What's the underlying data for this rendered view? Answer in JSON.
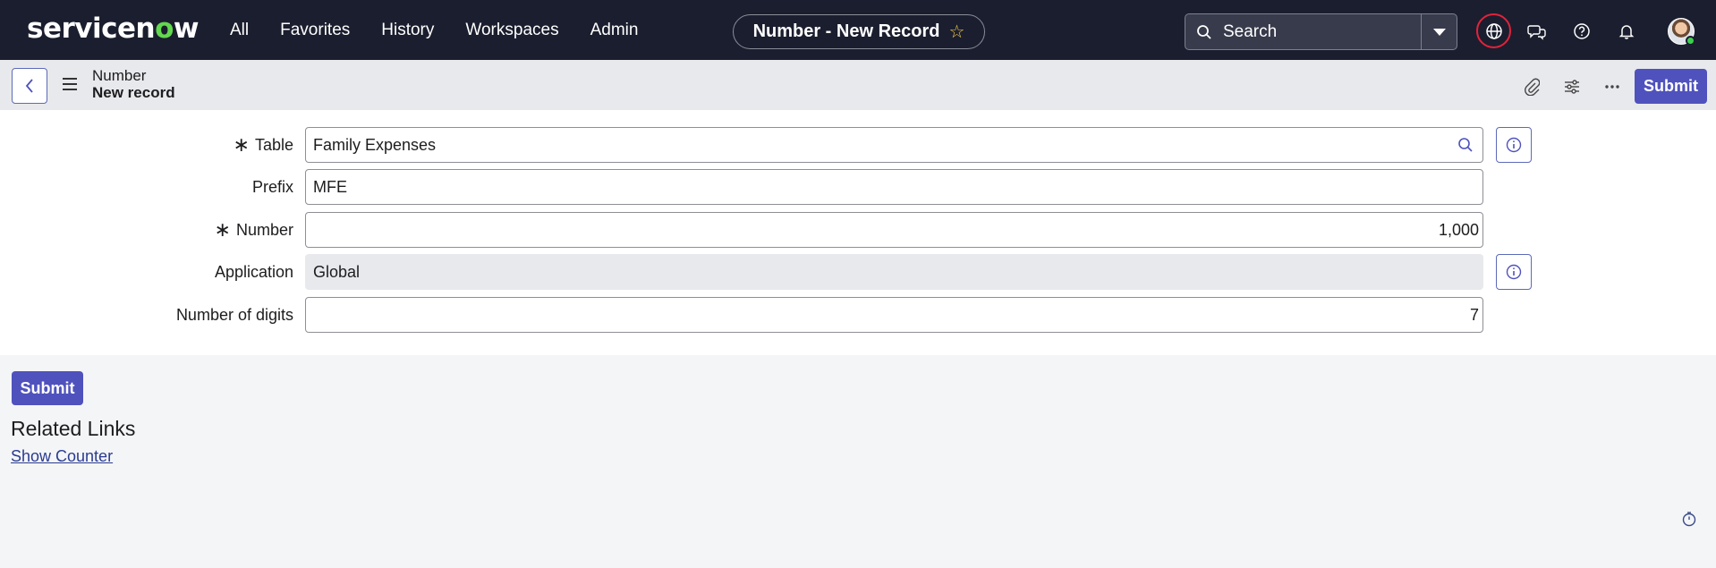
{
  "nav": {
    "logo_pre": "servicen",
    "logo_o": "o",
    "logo_post": "w",
    "links": [
      "All",
      "Favorites",
      "History",
      "Workspaces",
      "Admin"
    ],
    "page_title": "Number - New Record",
    "search_placeholder": "Search",
    "icons": [
      "search-icon",
      "chevron-down-icon",
      "globe-icon",
      "chat-icon",
      "help-icon",
      "bell-icon",
      "avatar"
    ]
  },
  "header": {
    "line1": "Number",
    "line2": "New record",
    "submit_label": "Submit",
    "icons": [
      "back-icon",
      "hamburger-icon",
      "paperclip-icon",
      "sliders-icon",
      "more-icon"
    ]
  },
  "form": {
    "table_label": "Table",
    "table_value": "Family Expenses",
    "prefix_label": "Prefix",
    "prefix_value": "MFE",
    "number_label": "Number",
    "number_value": "1,000",
    "application_label": "Application",
    "application_value": "Global",
    "digits_label": "Number of digits",
    "digits_value": "7",
    "required_mark": "∗"
  },
  "footer": {
    "submit_label": "Submit",
    "related_title": "Related Links",
    "related_link": "Show Counter"
  },
  "colors": {
    "nav_bg": "#1b1e2e",
    "accent": "#4f52bd",
    "logo_o": "#62d84e",
    "alert_ring": "#e0233b"
  }
}
